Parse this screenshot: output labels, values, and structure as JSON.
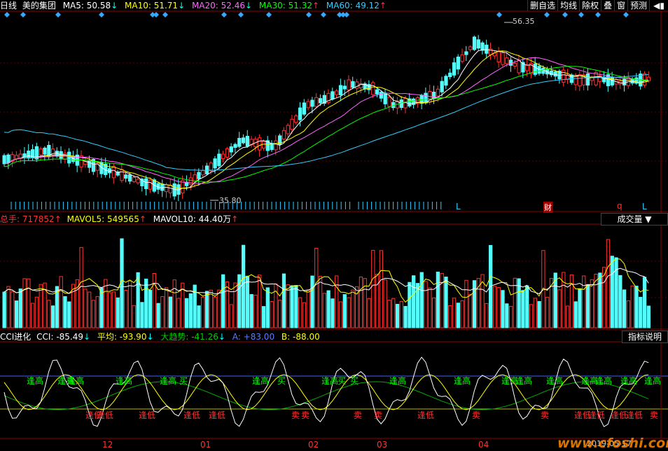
{
  "header": {
    "period": "日线",
    "stock_name": "美的集团",
    "ma": [
      {
        "label": "MA5",
        "value": "50.58",
        "arrow": "↓",
        "color": "#ffffff"
      },
      {
        "label": "MA10",
        "value": "51.71",
        "arrow": "↓",
        "color": "#ffff00"
      },
      {
        "label": "MA20",
        "value": "52.46",
        "arrow": "↓",
        "color": "#ff66ff"
      },
      {
        "label": "MA30",
        "value": "51.32",
        "arrow": "↑",
        "color": "#00ff00"
      },
      {
        "label": "MA60",
        "value": "49.12",
        "arrow": "↑",
        "color": "#33ccff"
      }
    ]
  },
  "toolbar": {
    "delete_watch": "删自选",
    "ma_line": "均线",
    "exright": "除权",
    "overlay": "叠",
    "window": "窗",
    "forecast": "预测",
    "arrow": "◀▮"
  },
  "price_panel": {
    "high_label": "56.35",
    "low_label": "35.80",
    "marks": [
      "L",
      "L",
      "财",
      "q",
      "L"
    ]
  },
  "volume_panel": {
    "total_label": "总手:",
    "total_value": "717852",
    "mavol5_label": "MAVOL5:",
    "mavol5_value": "549565",
    "mavol10_label": "MAVOL10:",
    "mavol10_value": "44.40万",
    "dropdown": "成交量 ▼"
  },
  "cci_panel": {
    "title": "CCI进化",
    "cci_label": "CCI:",
    "cci_value": "-85.49",
    "avg_label": "平均:",
    "avg_value": "-93.90",
    "trend_label": "大趋势:",
    "trend_value": "-41.26",
    "a_label": "A:",
    "a_value": "+83.00",
    "b_label": "B:",
    "b_value": "-88.00",
    "help": "指标说明",
    "signal_high": "逢高",
    "signal_low": "逢低",
    "signal_buy": "买",
    "signal_sell": "卖"
  },
  "x_axis": {
    "months": [
      "12",
      "01",
      "02",
      "03",
      "04"
    ]
  },
  "watermark": "www.cfoshi.com",
  "date_stamp": "2019-05-17",
  "colors": {
    "up": "#ff3232",
    "down": "#54fcfc",
    "grid": "#8b0000",
    "ma5": "#ffffff",
    "ma10": "#ffff00",
    "ma20": "#ff66ff",
    "ma30": "#00ff00",
    "ma60": "#33ccff"
  }
}
